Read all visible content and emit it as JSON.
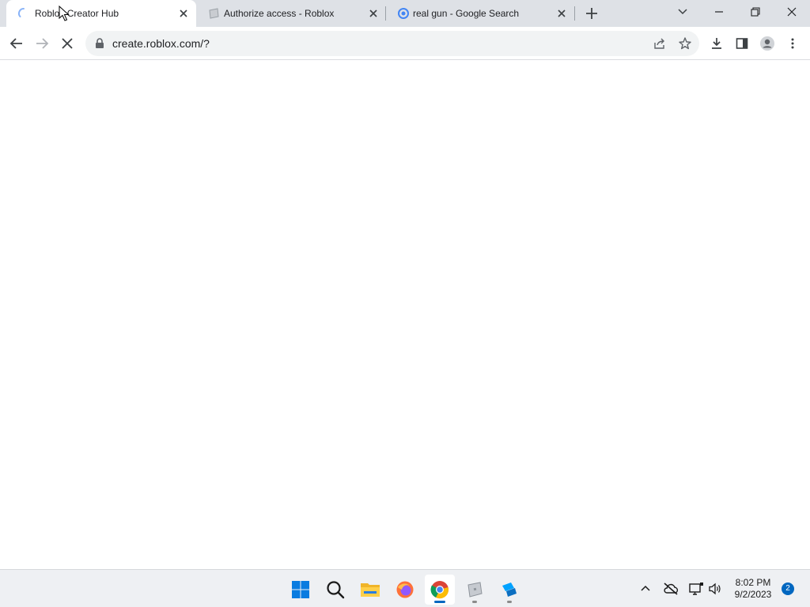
{
  "browser": {
    "tabs": [
      {
        "title": "Roblox Creator Hub",
        "state": "loading",
        "active": true
      },
      {
        "title": "Authorize access - Roblox",
        "active": false
      },
      {
        "title": "real gun - Google Search",
        "active": false
      }
    ],
    "address_bar": {
      "url": "create.roblox.com/?"
    }
  },
  "taskbar": {
    "apps": [
      "windows-start-icon",
      "search-icon",
      "file-explorer-icon",
      "firefox-icon",
      "chrome-icon",
      "roblox-player-icon",
      "roblox-studio-icon"
    ],
    "clock": {
      "time": "8:02 PM",
      "date": "9/2/2023"
    },
    "notification_count": "2"
  },
  "colors": {
    "accent": "#0067c0",
    "tabstrip": "#dee1e6",
    "omnibox": "#f1f3f4",
    "taskbar": "#eef0f3"
  }
}
